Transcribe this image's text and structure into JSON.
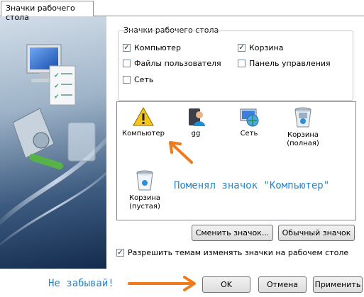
{
  "tab": {
    "label": "Значки рабочего стола"
  },
  "group": {
    "legend": "Значки рабочего стола",
    "checkboxes": [
      {
        "label": "Компьютер",
        "checked": true
      },
      {
        "label": "Корзина",
        "checked": true
      },
      {
        "label": "Файлы пользователя",
        "checked": false
      },
      {
        "label": "Панель управления",
        "checked": false
      },
      {
        "label": "Сеть",
        "checked": false
      }
    ]
  },
  "icons": [
    {
      "label": "Компьютер",
      "icon": "warning-icon"
    },
    {
      "label": "gg",
      "icon": "user-icon"
    },
    {
      "label": "Сеть",
      "icon": "network-icon"
    },
    {
      "label": "Корзина (полная)",
      "icon": "recycle-bin-full-icon"
    },
    {
      "label": "Корзина (пустая)",
      "icon": "recycle-bin-empty-icon"
    }
  ],
  "buttons": {
    "change_icon": "Сменить значок...",
    "default_icon": "Обычный значок",
    "ok": "OK",
    "cancel": "Отмена",
    "apply": "Применить"
  },
  "themes_checkbox": {
    "label": "Разрешить темам изменять значки на рабочем столе",
    "checked": true
  },
  "annotations": {
    "changed_icon": "Поменял значок \"Компьютер\"",
    "reminder": "Не забывай!"
  },
  "colors": {
    "annotation_text": "#2a86c8",
    "annotation_arrow": "#f07a1c"
  }
}
